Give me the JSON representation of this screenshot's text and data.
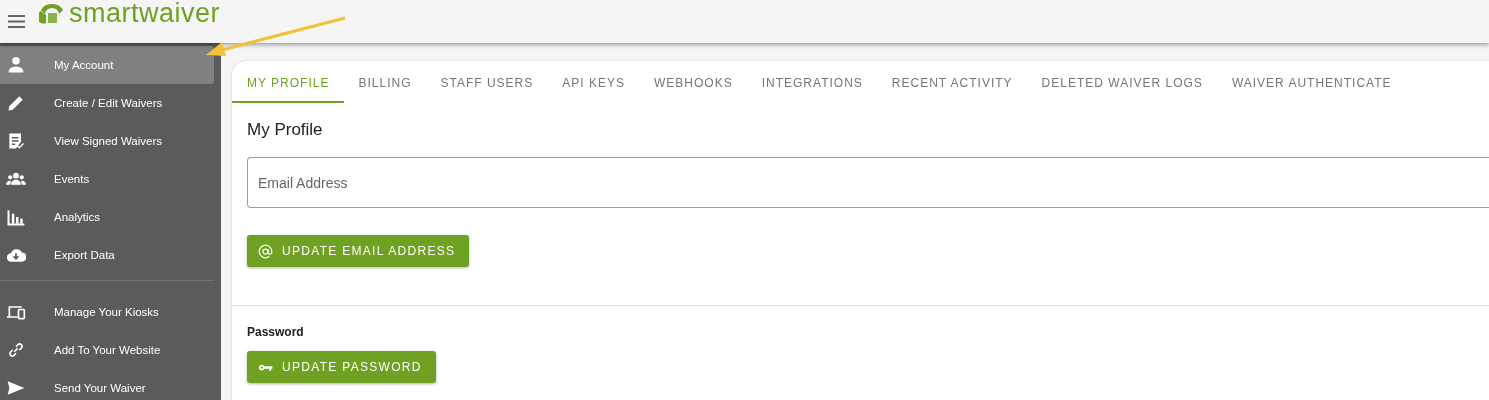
{
  "header": {
    "logo": "smartwaiver"
  },
  "sidebar": {
    "sections": [
      [
        {
          "label": "My Account",
          "kind": "person",
          "selected": true
        },
        {
          "label": "Create / Edit Waivers",
          "kind": "pencil",
          "selected": false
        },
        {
          "label": "View Signed Waivers",
          "kind": "document",
          "selected": false
        },
        {
          "label": "Events",
          "kind": "group",
          "selected": false
        },
        {
          "label": "Analytics",
          "kind": "bars",
          "selected": false
        },
        {
          "label": "Export Data",
          "kind": "cloud",
          "selected": false
        }
      ],
      [
        {
          "label": "Manage Your Kiosks",
          "kind": "devices",
          "selected": false
        },
        {
          "label": "Add To Your Website",
          "kind": "link",
          "selected": false
        },
        {
          "label": "Send Your Waiver",
          "kind": "send",
          "selected": false
        }
      ]
    ]
  },
  "tabs": [
    {
      "label": "MY PROFILE",
      "selected": true
    },
    {
      "label": "BILLING",
      "selected": false
    },
    {
      "label": "STAFF USERS",
      "selected": false
    },
    {
      "label": "API KEYS",
      "selected": false
    },
    {
      "label": "WEBHOOKS",
      "selected": false
    },
    {
      "label": "INTEGRATIONS",
      "selected": false
    },
    {
      "label": "RECENT ACTIVITY",
      "selected": false
    },
    {
      "label": "DELETED WAIVER LOGS",
      "selected": false
    },
    {
      "label": "WAIVER AUTHENTICATE",
      "selected": false
    }
  ],
  "profile": {
    "title": "My Profile",
    "email_field": {
      "placeholder": "Email Address"
    },
    "email_button": "UPDATE EMAIL ADDRESS",
    "password_label": "Password",
    "password_button": "UPDATE PASSWORD"
  }
}
